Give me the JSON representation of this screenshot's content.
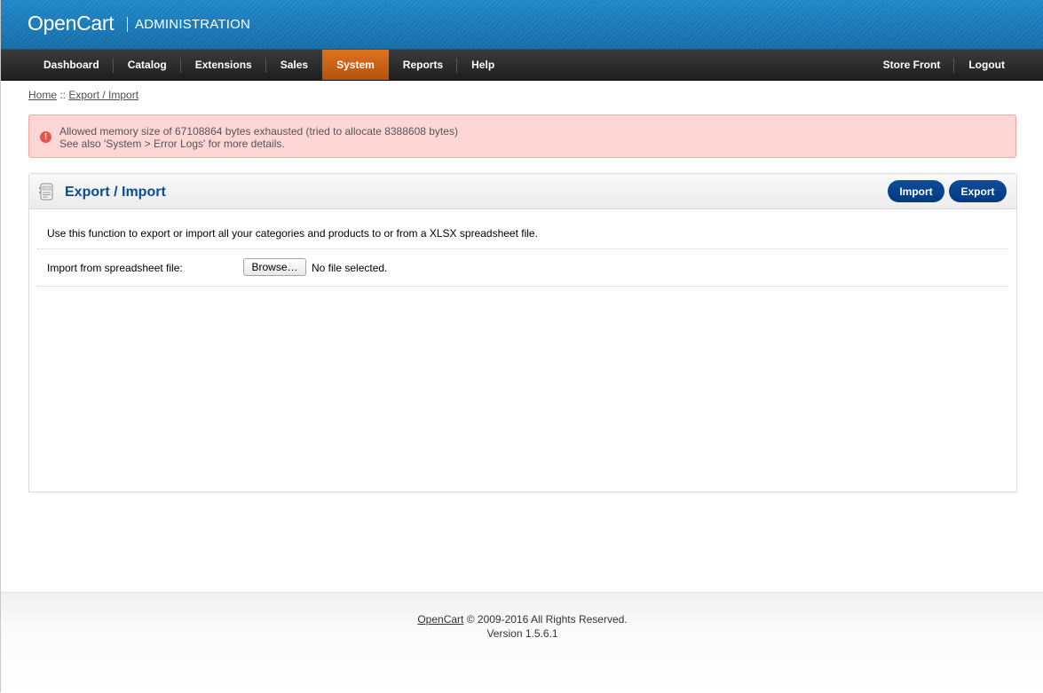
{
  "header": {
    "logo": "OpenCart",
    "subtitle": "ADMINISTRATION"
  },
  "menu": {
    "left": [
      {
        "label": "Dashboard"
      },
      {
        "label": "Catalog"
      },
      {
        "label": "Extensions"
      },
      {
        "label": "Sales"
      },
      {
        "label": "System",
        "active": true
      },
      {
        "label": "Reports"
      },
      {
        "label": "Help"
      }
    ],
    "right": [
      {
        "label": "Store Front"
      },
      {
        "label": "Logout"
      }
    ]
  },
  "breadcrumb": {
    "home": "Home",
    "separator": " :: ",
    "current": "Export / Import"
  },
  "warning": {
    "line1": "Allowed memory size of 67108864 bytes exhausted (tried to allocate 8388608 bytes)",
    "line2": "See also 'System > Error Logs' for more details.",
    "icon": "error-icon",
    "color": "#ffd6d6"
  },
  "box": {
    "title": "Export / Import",
    "icon": "module-icon",
    "import_label": "Import",
    "export_label": "Export",
    "description": "Use this function to export or import all your categories and products to or from a XLSX spreadsheet file.",
    "file_label": "Import from spreadsheet file:",
    "browse_label": "Browse…",
    "file_status": "No file selected."
  },
  "footer": {
    "link": "OpenCart",
    "copyright": " © 2009-2016 All Rights Reserved.",
    "version": "Version 1.5.6.1"
  },
  "colors": {
    "header_blue": "#1d86c8",
    "active_orange": "#e0721f",
    "button_blue": "#0f4d9a",
    "title_blue": "#0a4e8f"
  }
}
